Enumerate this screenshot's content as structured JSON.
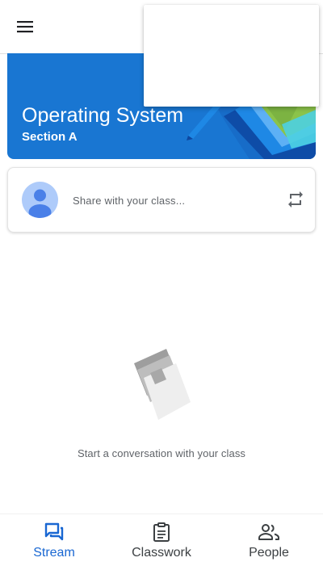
{
  "app_bar": {
    "menu_icon": "hamburger-menu-icon"
  },
  "banner": {
    "title": "Operating System",
    "section": "Section A",
    "color": "#1976d2"
  },
  "share_card": {
    "placeholder": "Share with your class...",
    "avatar_icon": "person-avatar-icon",
    "repost_icon": "repost-icon"
  },
  "empty_state": {
    "icon": "conversation-papers-icon",
    "message": "Start a conversation with your class"
  },
  "bottom_nav": {
    "active_color": "#1967d2",
    "items": [
      {
        "label": "Stream",
        "icon": "stream-icon",
        "active": true
      },
      {
        "label": "Classwork",
        "icon": "classwork-icon",
        "active": false
      },
      {
        "label": "People",
        "icon": "people-icon",
        "active": false
      }
    ]
  }
}
